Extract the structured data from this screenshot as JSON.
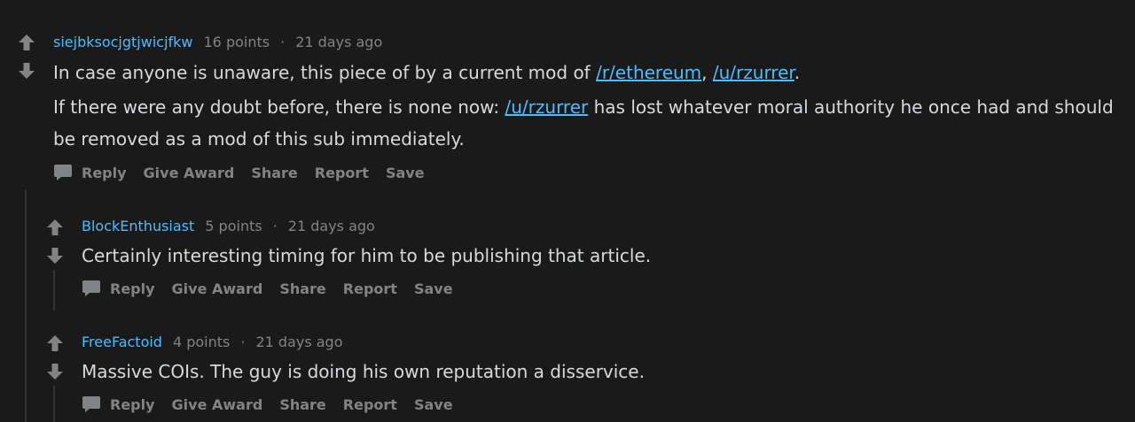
{
  "comments": [
    {
      "author": "siejbksocjgtjwicjfkw",
      "points": "16 points",
      "separator": "·",
      "time": "21 days ago",
      "paragraph1": {
        "text_before": "In case anyone is unaware, this piece of by a current mod of ",
        "link1": "/r/ethereum",
        "between": ", ",
        "link2": "/u/rzurrer",
        "text_after": "."
      },
      "paragraph2": {
        "text_before": "If there were any doubt before, there is none now: ",
        "link1": "/u/rzurrer",
        "text_after": " has lost whatever moral authority he once had and should be removed as a mod of this sub immediately."
      },
      "actions": [
        "Reply",
        "Give Award",
        "Share",
        "Report",
        "Save"
      ]
    },
    {
      "author": "BlockEnthusiast",
      "points": "5 points",
      "separator": "·",
      "time": "21 days ago",
      "body": "Certainly interesting timing for him to be publishing that article.",
      "actions": [
        "Reply",
        "Give Award",
        "Share",
        "Report",
        "Save"
      ]
    },
    {
      "author": "FreeFactoid",
      "points": "4 points",
      "separator": "·",
      "time": "21 days ago",
      "body": "Massive COIs. The guy is doing his own reputation a disservice.",
      "actions": [
        "Reply",
        "Give Award",
        "Share",
        "Report",
        "Save"
      ]
    }
  ],
  "colors": {
    "background": "#1a1a1b",
    "author": "#4fbcff",
    "link": "#4fbcff",
    "body_text": "#d7dadc",
    "meta_text": "#818384",
    "thread_line": "#343536"
  },
  "icons": {
    "upvote": "upvote-arrow-icon",
    "downvote": "downvote-arrow-icon",
    "reply": "speech-bubble-icon"
  }
}
